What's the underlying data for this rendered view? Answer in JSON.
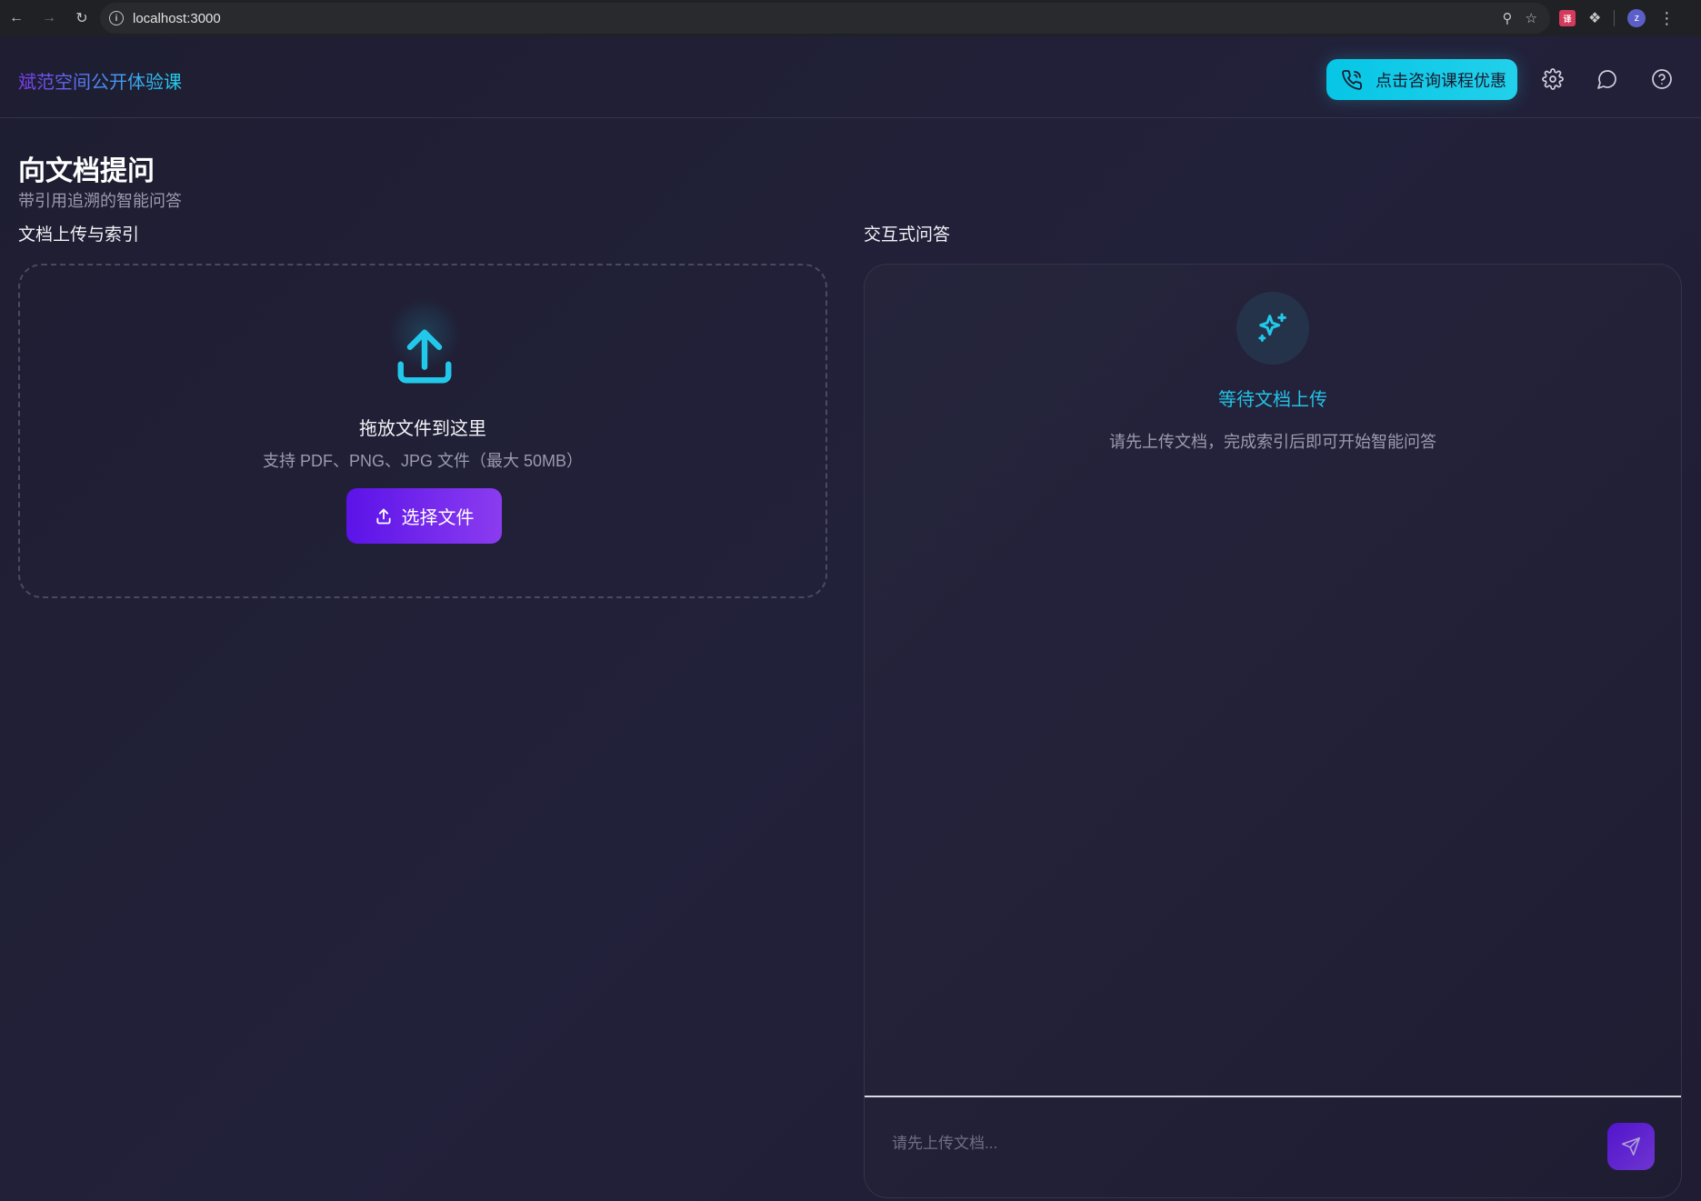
{
  "browser": {
    "url": "localhost:3000",
    "avatar_letter": "z",
    "extension_badge": "译"
  },
  "header": {
    "brand": "斌范空间公开体验课",
    "consult_label": "点击咨询课程优惠",
    "icons": [
      "phone-icon",
      "settings-icon",
      "chat-icon",
      "help-icon"
    ]
  },
  "page": {
    "title": "向文档提问",
    "subtitle": "带引用追溯的智能问答"
  },
  "upload": {
    "section_label": "文档上传与索引",
    "drop_title": "拖放文件到这里",
    "drop_hint": "支持 PDF、PNG、JPG 文件（最大 50MB）",
    "choose_label": "选择文件"
  },
  "qa": {
    "section_label": "交互式问答",
    "wait_title": "等待文档上传",
    "wait_desc": "请先上传文档，完成索引后即可开始智能问答",
    "input_placeholder": "请先上传文档..."
  },
  "colors": {
    "background": "#1f1e33",
    "accent_cyan": "#22d3ee",
    "accent_purple": "#6d28d9"
  }
}
